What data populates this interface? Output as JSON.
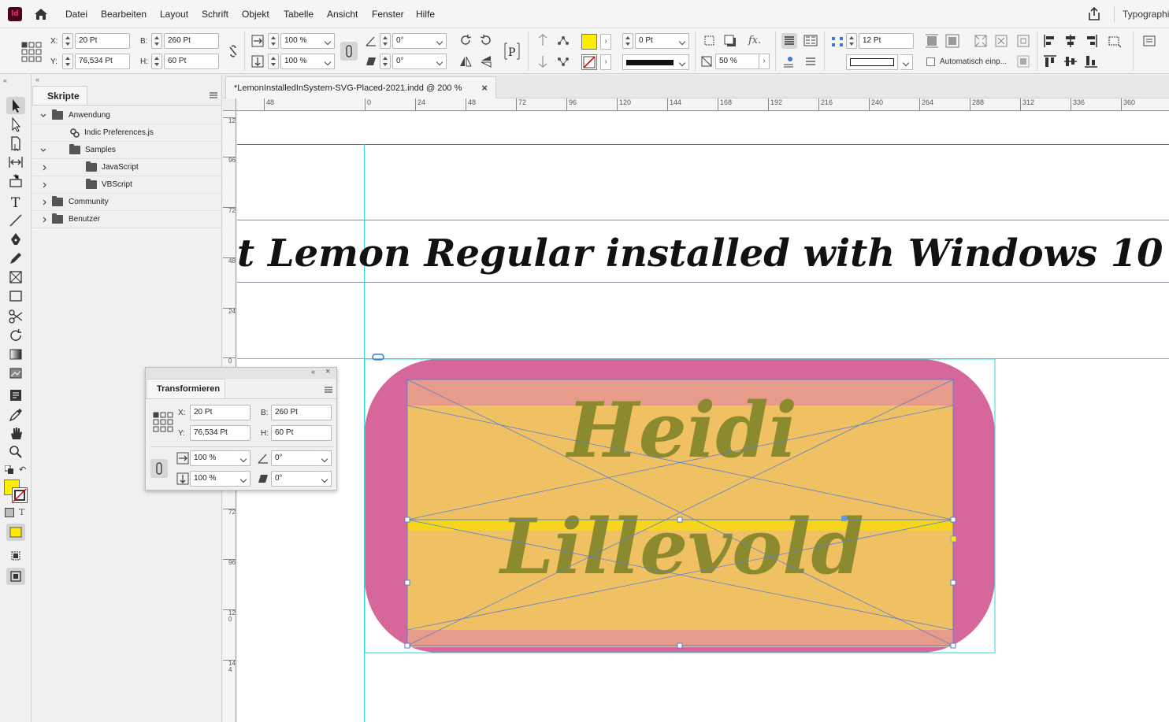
{
  "app": {
    "logo_text": "Id",
    "workspace": "Typographie"
  },
  "menu": [
    "Datei",
    "Bearbeiten",
    "Layout",
    "Schrift",
    "Objekt",
    "Tabelle",
    "Ansicht",
    "Fenster",
    "Hilfe"
  ],
  "control": {
    "x_label": "X:",
    "x_value": "20 Pt",
    "y_label": "Y:",
    "y_value": "76,534 Pt",
    "w_label": "B:",
    "w_value": "260 Pt",
    "h_label": "H:",
    "h_value": "60 Pt",
    "scale_x": "100 %",
    "scale_y": "100 %",
    "rotate": "0°",
    "shear": "0°",
    "stroke_weight": "0 Pt",
    "opacity": "50 %",
    "columns_gutter": "12 Pt",
    "autofit_label": "Automatisch einp...",
    "fill_color": "#ffec00"
  },
  "scripts": {
    "tab": "Skripte",
    "tree": [
      {
        "label": "Anwendung",
        "level": 0,
        "expanded": true,
        "type": "folder"
      },
      {
        "label": "Indic Preferences.js",
        "level": 1,
        "type": "script"
      },
      {
        "label": "Samples",
        "level": 1,
        "expanded": true,
        "type": "folder"
      },
      {
        "label": "JavaScript",
        "level": 2,
        "expanded": false,
        "type": "folder"
      },
      {
        "label": "VBScript",
        "level": 2,
        "expanded": false,
        "type": "folder"
      },
      {
        "label": "Community",
        "level": 0,
        "expanded": false,
        "type": "folder"
      },
      {
        "label": "Benutzer",
        "level": 0,
        "expanded": false,
        "type": "folder"
      }
    ]
  },
  "document": {
    "tab_title": "*LemonInstalledInSystem-SVG-Placed-2021.indd @ 200 %",
    "close_glyph": "×",
    "hruler_ticks": [
      "48",
      "0",
      "24",
      "48",
      "72",
      "96",
      "120",
      "144",
      "168",
      "192",
      "216",
      "240",
      "264",
      "288",
      "312",
      "336",
      "360"
    ],
    "vruler_ticks": [
      "12",
      "96",
      "72",
      "48",
      "24",
      "0",
      "24",
      "48",
      "72",
      "96",
      "120",
      "144"
    ],
    "headline": "t Lemon Regular installed with Windows 10",
    "graphic_word_1": "Heidi",
    "graphic_word_2": "Lillevold",
    "colors": {
      "frame_pink": "#d6679b",
      "inner_orange": "#f0c162",
      "text_olive": "#8c8a2e",
      "band_pink": "#e79b8a",
      "stripe_yellow": "#f7d51d",
      "frame_stroke": "#5b7fd6",
      "guide_cyan": "#33d7d7",
      "guide_magenta": "#e24fd0"
    }
  },
  "transform_panel": {
    "tab": "Transformieren",
    "x_label": "X:",
    "x_value": "20 Pt",
    "y_label": "Y:",
    "y_value": "76,534 Pt",
    "w_label": "B:",
    "w_value": "260 Pt",
    "h_label": "H:",
    "h_value": "60 Pt",
    "scale_x": "100 %",
    "scale_y": "100 %",
    "rotate": "0°",
    "shear": "0°"
  }
}
